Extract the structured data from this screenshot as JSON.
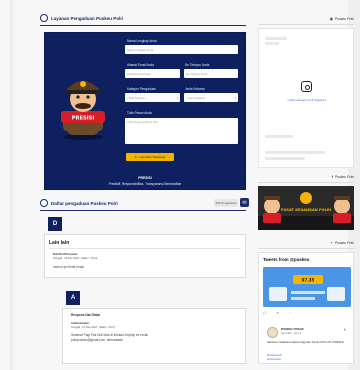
{
  "form_section": {
    "title": "Layanan Pengaduan Puskeu Polri",
    "fields": {
      "name_label": "Nama Lengkap Anda",
      "name_placeholder": "Nama Lengkap Anda",
      "email_label": "Alamat Email Anda",
      "email_placeholder": "Alamat Email Anda",
      "phone_label": "No Telepon Anda",
      "phone_placeholder": "No Telepon Anda",
      "category_label": "Kategori Pengaduan",
      "category_value": "- Pilih Kategori -",
      "gender_label": "Jenis Kelamin",
      "gender_value": "- Jenis Kelamin -",
      "message_label": "Tulis Pesan Anda",
      "message_placeholder": "Tulis Pesan Anda Di Sini . . ."
    },
    "submit_label": "Laporkan Sekarang",
    "footer_title": "PRESISI",
    "footer_tagline": "Prediktif, Responsibilitas, Transparansi Berkeadilan",
    "mascot_badge": "PRESISI"
  },
  "complaints_section": {
    "title": "Daftar pengaduan Puskeu Polri",
    "count_label": "333 Pengaduan",
    "item": {
      "avatar_letter": "D",
      "title": "Lain lain",
      "author": "Ddd Dod Punoanu",
      "meta": "Tanggal : 29 Nov 2022 - Waktu : 15:22",
      "body": "mohon ijin firvat email"
    },
    "reply": {
      "avatar_letter": "A",
      "title": "Respons Dari Balai",
      "author": "Administrator",
      "meta": "Tanggal : 07 Des 2022 - Waktu : 09:27",
      "body_line1": "Selamat Pagi Pak Didi bisa di infokan Anyinip ke email",
      "body_line2": "polripuskeu@gmail.com, terimakasih"
    }
  },
  "sidebar": {
    "instagram_header": "Puskeu Polri",
    "instagram_link": "Lihat postingan ini di Instagram",
    "facebook_header": "Puskeu Polri",
    "banner_text": "PUSAT KEUANGAN POLRI",
    "twitter_header": "Puskeu Polri",
    "tweets_title": "Tweets from @puskeu",
    "tweet_name": "PUSKEU POLRI",
    "tweet_handle": "@puskeu · Nov 6",
    "tweet_text": "Sebelum melakukan lapisan lagi dan Turutin Polri LITU PRESISI",
    "tweet_tags": "#puskeupolri\n#polripresisi",
    "tweet_media_label": "97.35"
  },
  "colors": {
    "navy": "#0e2060",
    "accent": "#f4b400",
    "link": "#3f6bd8"
  }
}
